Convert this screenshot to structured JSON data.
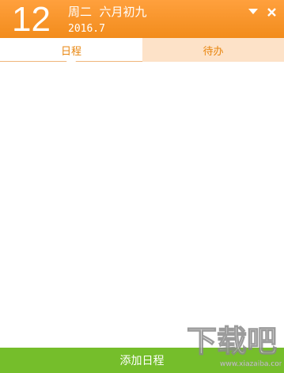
{
  "header": {
    "day": "12",
    "weekday_lunar": "周二  六月初九",
    "year_month": "2016.7"
  },
  "tabs": [
    {
      "label": "日程",
      "active": true
    },
    {
      "label": "待办",
      "active": false
    }
  ],
  "footer": {
    "add_label": "添加日程"
  },
  "watermark": {
    "text": "下载吧",
    "url_text": "www.xiazaiba.com"
  },
  "colors": {
    "header": "#f59024",
    "accent": "#e8860f",
    "inactive_tab": "#fde2c8",
    "footer": "#75be2b"
  },
  "icons": {
    "dropdown": "chevron-down-icon",
    "close": "close-icon"
  }
}
